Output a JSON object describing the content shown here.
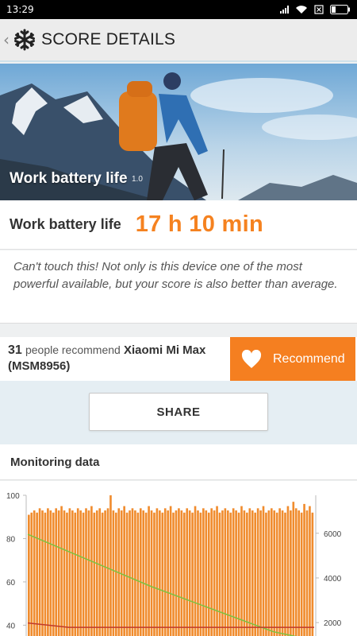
{
  "status_bar": {
    "time": "13:29"
  },
  "header": {
    "title": "SCORE DETAILS",
    "back_icon": "chevron-left-icon",
    "logo_icon": "snowflake-logo-icon"
  },
  "hero": {
    "title": "Work battery life",
    "version": "1.0"
  },
  "score": {
    "label": "Work battery life",
    "value": "17 h 10 min"
  },
  "description": "Can't touch this! Not only is this device one of the most powerful available, but your score is also better than average.",
  "recommend": {
    "count": "31",
    "people_text": "people recommend",
    "device": "Xiaomi Mi Max (MSM8956)",
    "button_label": "Recommend"
  },
  "share": {
    "label": "SHARE"
  },
  "monitoring": {
    "title": "Monitoring data"
  },
  "colors": {
    "accent": "#f57f20",
    "score": "#f58220",
    "share_band": "#e5eef3"
  },
  "chart_data": {
    "type": "bar",
    "title": "",
    "y_left_ticks": [
      "100",
      "80",
      "60",
      "40"
    ],
    "y_right_ticks": [
      "6000",
      "4000",
      "2000"
    ],
    "ylim_left": [
      35,
      100
    ],
    "ylim_right": [
      1400,
      7700
    ],
    "series": [
      {
        "kind": "bar",
        "color": "#f08c2e",
        "values": [
          91,
          92,
          93,
          92,
          94,
          93,
          92,
          94,
          93,
          92,
          94,
          93,
          95,
          93,
          92,
          94,
          93,
          92,
          94,
          93,
          92,
          94,
          93,
          95,
          92,
          93,
          94,
          92,
          93,
          94,
          100,
          93,
          92,
          94,
          93,
          95,
          92,
          93,
          94,
          93,
          92,
          94,
          93,
          92,
          95,
          93,
          92,
          94,
          93,
          92,
          94,
          93,
          95,
          92,
          93,
          94,
          93,
          92,
          94,
          93,
          92,
          95,
          93,
          92,
          94,
          93,
          92,
          94,
          93,
          95,
          92,
          93,
          94,
          93,
          92,
          94,
          93,
          92,
          95,
          93,
          92,
          94,
          93,
          92,
          94,
          93,
          95,
          92,
          93,
          94,
          93,
          92,
          94,
          93,
          92,
          95,
          93,
          97,
          94,
          93,
          92,
          96,
          93,
          95,
          92
        ]
      },
      {
        "kind": "line",
        "color": "#7dc242",
        "values": [
          82,
          74,
          66,
          58,
          51,
          44,
          37,
          33
        ]
      },
      {
        "kind": "line",
        "color": "#c0392b",
        "values": [
          41,
          39,
          39,
          39,
          39,
          39,
          39,
          39
        ]
      }
    ]
  }
}
